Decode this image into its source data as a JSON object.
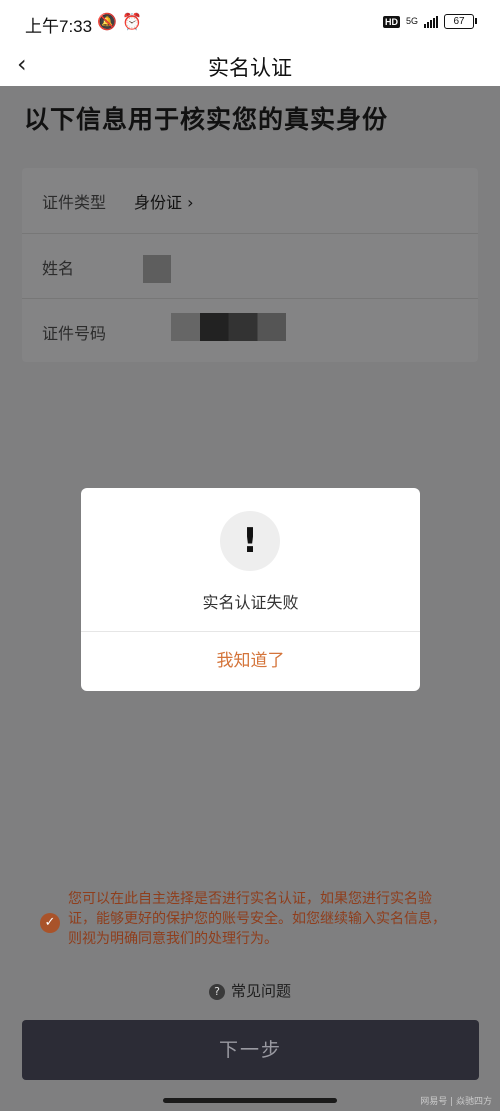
{
  "status": {
    "time": "上午7:33",
    "battery": "67",
    "network": "5G",
    "hd": "HD"
  },
  "nav": {
    "title": "实名认证"
  },
  "heading": "以下信息用于核实您的真实身份",
  "form": {
    "rows": [
      {
        "label": "证件类型",
        "value": "身份证"
      },
      {
        "label": "姓名"
      },
      {
        "label": "证件号码"
      }
    ]
  },
  "dialog": {
    "icon_glyph": "!",
    "message": "实名认证失败",
    "button": "我知道了"
  },
  "consent": {
    "text": "您可以在此自主选择是否进行实名认证，如果您进行实名验证，能够更好的保护您的账号安全。如您继续输入实名信息，则视为明确同意我们的处理行为。"
  },
  "faq": {
    "label": "常见问题",
    "icon_glyph": "?"
  },
  "next_button": "下一步",
  "watermark": "网易号 | 焱驰四方",
  "colors": {
    "accent": "#d4743a",
    "dark_button": "#2c2c36"
  },
  "icons": [
    "chevron-left-icon",
    "alert-icon",
    "check-circle-icon",
    "help-circle-icon"
  ]
}
